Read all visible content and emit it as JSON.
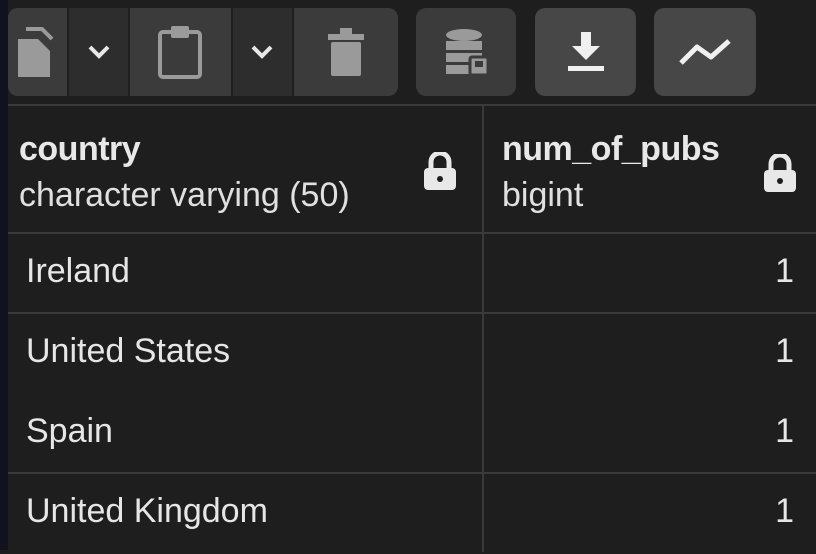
{
  "toolbar": {
    "buttons": [
      {
        "name": "copy-icon"
      },
      {
        "name": "chevron-down-icon"
      },
      {
        "name": "clipboard-icon"
      },
      {
        "name": "chevron-down-icon"
      },
      {
        "name": "trash-icon"
      },
      {
        "name": "save-data-icon"
      },
      {
        "name": "download-icon"
      },
      {
        "name": "graph-icon"
      }
    ]
  },
  "columns": [
    {
      "name": "country",
      "type": "character varying (50)",
      "icon": "lock-icon"
    },
    {
      "name": "num_of_pubs",
      "type": "bigint",
      "icon": "lock-icon"
    }
  ],
  "rows": [
    {
      "country": "Ireland",
      "num_of_pubs": "1"
    },
    {
      "country": "United States",
      "num_of_pubs": "1"
    },
    {
      "country": "Spain",
      "num_of_pubs": "1"
    },
    {
      "country": "United Kingdom",
      "num_of_pubs": "1"
    }
  ],
  "colors": {
    "background": "#1e1e1e",
    "button": "#3b3b3b",
    "grid_line": "#3a3a3a",
    "text": "#e6e6e6"
  }
}
